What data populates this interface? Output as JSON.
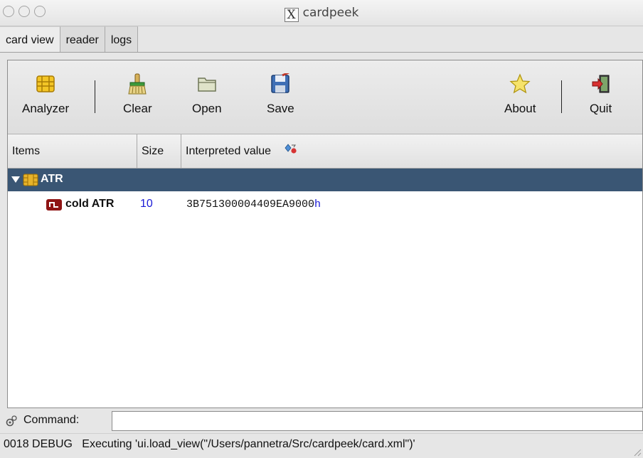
{
  "window": {
    "title": "cardpeek"
  },
  "tabs": [
    {
      "label": "card view"
    },
    {
      "label": "reader"
    },
    {
      "label": "logs"
    }
  ],
  "toolbar": {
    "analyzer": "Analyzer",
    "clear": "Clear",
    "open": "Open",
    "save": "Save",
    "about": "About",
    "quit": "Quit"
  },
  "table": {
    "columns": {
      "items": "Items",
      "size": "Size",
      "interpreted": "Interpreted value"
    },
    "root": {
      "label": "ATR"
    },
    "child": {
      "label": "cold ATR",
      "size": "10",
      "value": "3B751300004409EA9000",
      "suffix": "h"
    }
  },
  "command": {
    "label": "Command:",
    "value": ""
  },
  "status": {
    "line": "0018 DEBUG   Executing 'ui.load_view(\"/Users/pannetra/Src/cardpeek/card.xml\")'"
  },
  "colors": {
    "selection": "#3a5674",
    "size_text": "#1a1ad6",
    "suffix_text": "#1a1ad6"
  },
  "icons": [
    "chip-icon",
    "broom-icon",
    "folder-icon",
    "floppy-icon",
    "star-icon",
    "exit-icon",
    "sort-icon",
    "expander-icon",
    "gear-icon"
  ]
}
